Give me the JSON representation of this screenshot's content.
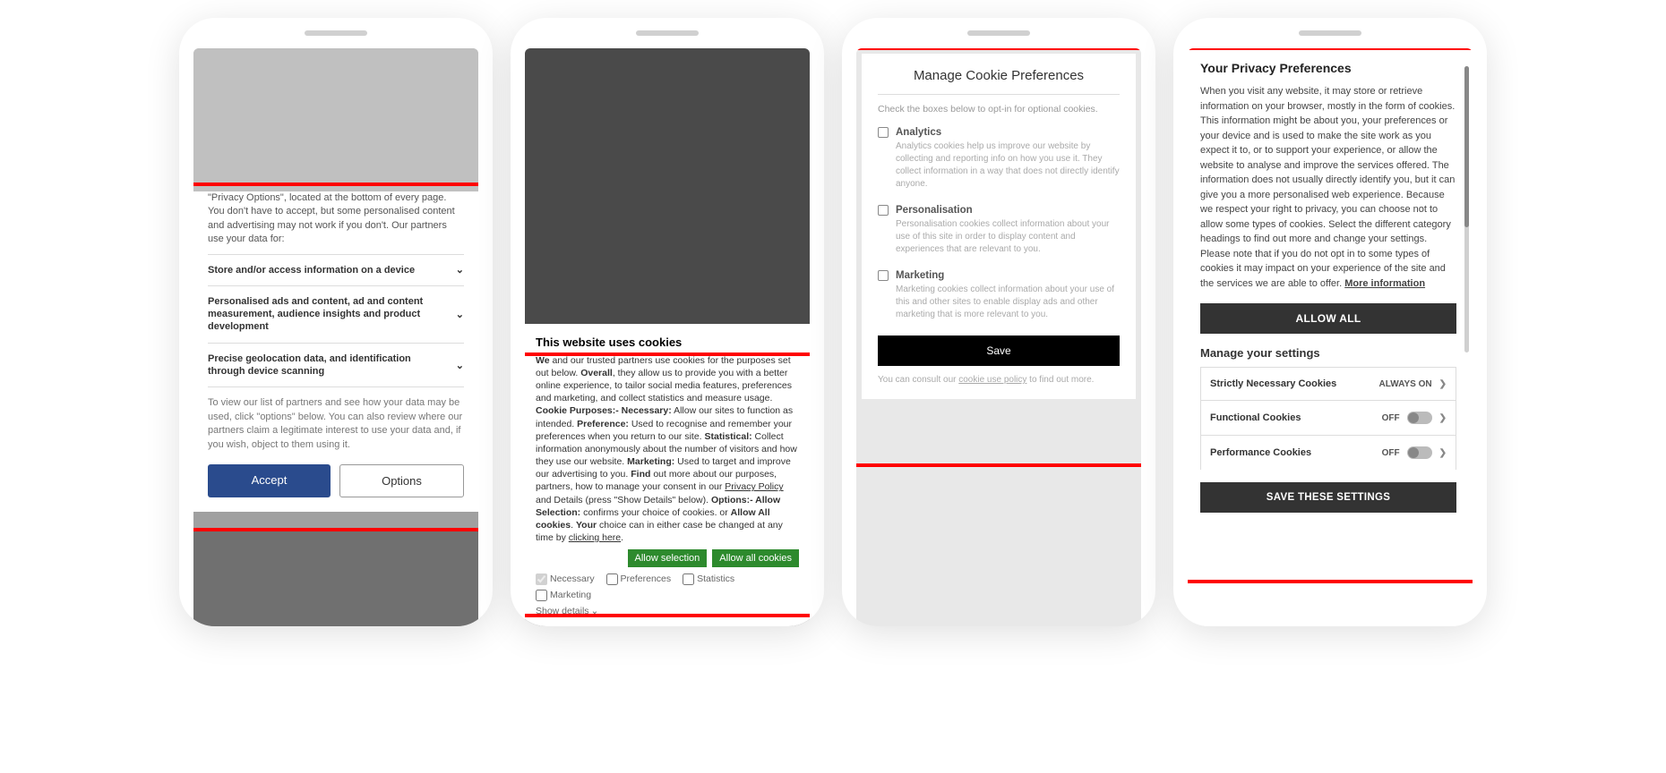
{
  "phone1": {
    "intro": "\"Privacy Options\", located at the bottom of every page. You don't have to accept, but some personalised content and advertising may not work if you don't. Our partners use your data for:",
    "rows": [
      "Store and/or access information on a device",
      "Personalised ads and content, ad and content measurement, audience insights and product development",
      "Precise geolocation data, and identification through device scanning"
    ],
    "note": "To view our list of partners and see how your data may be used, click \"options\" below. You can also review where our partners claim a legitimate interest to use your data and, if you wish, object to them using it.",
    "accept": "Accept",
    "options": "Options"
  },
  "phone2": {
    "title": "This website uses cookies",
    "body_parts": {
      "we": "We",
      "p1": " and our trusted partners use cookies for the purposes set out below. ",
      "overall": "Overall",
      "p2": ", they allow us to provide you with a better online experience, to tailor social media features, preferences and marketing, and collect statistics and measure usage. ",
      "cookie_purposes": "Cookie Purposes:- Necessary:",
      "p3": " Allow our sites to function as intended. ",
      "preference": "Preference:",
      "p4": " Used to recognise and remember your preferences when you return to our site. ",
      "statistical": "Statistical:",
      "p5": " Collect information anonymously about the number of visitors and how they use our website. ",
      "marketing": "Marketing:",
      "p6": " Used to target and improve our advertising to you. ",
      "find": "Find",
      "p7": " out more about our purposes, partners, how to manage your consent in our ",
      "privacy_link": "Privacy Policy",
      "p8": " and Details (press \"Show Details\" below). ",
      "options": "Options:- Allow Selection:",
      "p9": " confirms your choice of cookies. or ",
      "allow_all": "Allow All cookies",
      "p10": ". ",
      "your": "Your",
      "p11": " choice can in either case be changed at any time by ",
      "clicking_here": "clicking here",
      "p12": "."
    },
    "btn_selection": "Allow selection",
    "btn_all": "Allow all cookies",
    "cats": {
      "necessary": "Necessary",
      "preferences": "Preferences",
      "statistics": "Statistics",
      "marketing": "Marketing"
    },
    "show_details": "Show details"
  },
  "phone3": {
    "title": "Manage Cookie Preferences",
    "sub": "Check the boxes below to opt-in for optional cookies.",
    "items": [
      {
        "name": "Analytics",
        "desc": "Analytics cookies help us improve our website by collecting and reporting info on how you use it. They collect information in a way that does not directly identify anyone."
      },
      {
        "name": "Personalisation",
        "desc": "Personalisation cookies collect information about your use of this site in order to display content and experiences that are relevant to you."
      },
      {
        "name": "Marketing",
        "desc": "Marketing cookies collect information about your use of this and other sites to enable display ads and other marketing that is more relevant to you."
      }
    ],
    "save": "Save",
    "policy_pre": "You can consult our ",
    "policy_link": "cookie use policy",
    "policy_post": " to find out more."
  },
  "phone4": {
    "title": "Your Privacy Preferences",
    "body": "When you visit any website, it may store or retrieve information on your browser, mostly in the form of cookies. This information might be about you, your preferences or your device and is used to make the site work as you expect it to, or to support your experience, or allow the website to analyse and improve the services offered. The information does not usually directly identify you, but it can give you a more personalised web experience. Because we respect your right to privacy, you can choose not to allow some types of cookies. Select the different category headings to find out more and change your settings. Please note that if you do not opt in to some types of cookies it may impact on your experience of the site and the services we are able to offer.  ",
    "more": "More information",
    "allow_all": "ALLOW ALL",
    "manage": "Manage your settings",
    "rows": [
      {
        "name": "Strictly Necessary Cookies",
        "state": "ALWAYS ON",
        "toggle": false
      },
      {
        "name": "Functional Cookies",
        "state": "OFF",
        "toggle": true
      },
      {
        "name": "Performance Cookies",
        "state": "OFF",
        "toggle": true
      }
    ],
    "save": "SAVE THESE SETTINGS"
  }
}
